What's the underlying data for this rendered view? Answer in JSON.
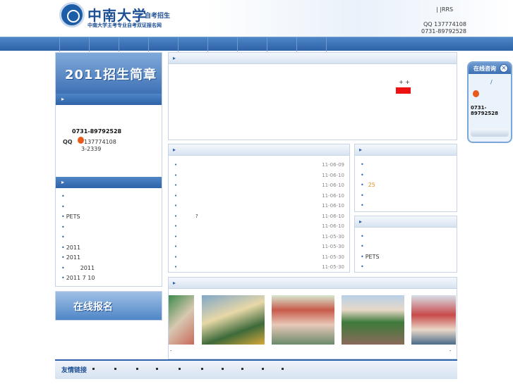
{
  "header": {
    "brand_title": "中南大学",
    "brand_sub": "自考招生",
    "tagline": "中南大学主考专业自考双证报名网",
    "top_links": "|   |RRS",
    "qq": "QQ 137774108",
    "phone": "0731-89792528"
  },
  "left": {
    "banner": "2011招生简章",
    "contact_phone": "0731-89792528",
    "contact_qq_label": "QQ",
    "contact_qq": "137774108",
    "contact_ext": "3-2339",
    "list": [
      "",
      "",
      "PETS",
      "",
      "",
      "2011",
      "2011",
      "2011",
      "2011 7 10"
    ],
    "online_reg": "在线报名"
  },
  "notice": {
    "plus_marks": "+ +"
  },
  "news": {
    "question_mark": "?",
    "dates": [
      "11-06-09",
      "11-06-10",
      "11-06-10",
      "11-06-10",
      "11-06-10",
      "11-06-10",
      "11-06-10",
      "11-05-30",
      "11-05-30",
      "11-05-30",
      "11-05-30"
    ]
  },
  "right_top": {
    "items": [
      "",
      "",
      "25",
      "",
      ""
    ]
  },
  "right_bottom": {
    "items": [
      "",
      "",
      "PETS",
      ""
    ]
  },
  "photos": {
    "captions": [
      "-",
      "-"
    ]
  },
  "footer": {
    "label": "友情链接"
  },
  "float_widget": {
    "title": "在线咨询",
    "close": "×",
    "slash": "/",
    "phone": "0731-89792528"
  },
  "colors": {
    "brand_blue": "#2d62a8",
    "accent_red": "#ee1111",
    "accent_orange": "#e88b1a"
  }
}
